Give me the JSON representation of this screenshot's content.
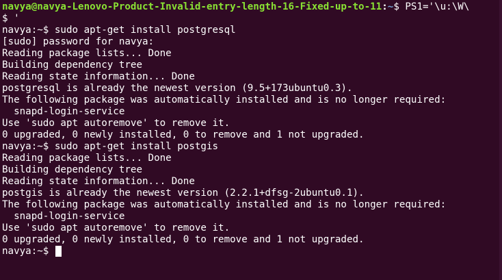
{
  "first_prompt": {
    "user_host": "navya@navya-Lenovo-Product-Invalid-entry-length-16-Fixed-up-to-11",
    "separator": ":",
    "path": "~",
    "command": "$ PS1='\\u:\\W\\"
  },
  "wrap_line": "$ '",
  "lines": [
    "navya:~$ sudo apt-get install postgresql",
    "[sudo] password for navya:",
    "Reading package lists... Done",
    "Building dependency tree",
    "Reading state information... Done",
    "postgresql is already the newest version (9.5+173ubuntu0.3).",
    "The following package was automatically installed and is no longer required:",
    "  snapd-login-service",
    "Use 'sudo apt autoremove' to remove it.",
    "0 upgraded, 0 newly installed, 0 to remove and 1 not upgraded.",
    "navya:~$ sudo apt-get install postgis",
    "Reading package lists... Done",
    "Building dependency tree",
    "Reading state information... Done",
    "postgis is already the newest version (2.2.1+dfsg-2ubuntu0.1).",
    "The following package was automatically installed and is no longer required:",
    "  snapd-login-service",
    "Use 'sudo apt autoremove' to remove it.",
    "0 upgraded, 0 newly installed, 0 to remove and 1 not upgraded."
  ],
  "current_prompt": "navya:~$ ",
  "colors": {
    "background": "#300a24",
    "text": "#ffffff",
    "user_host": "#8ae234",
    "path": "#729fcf"
  }
}
